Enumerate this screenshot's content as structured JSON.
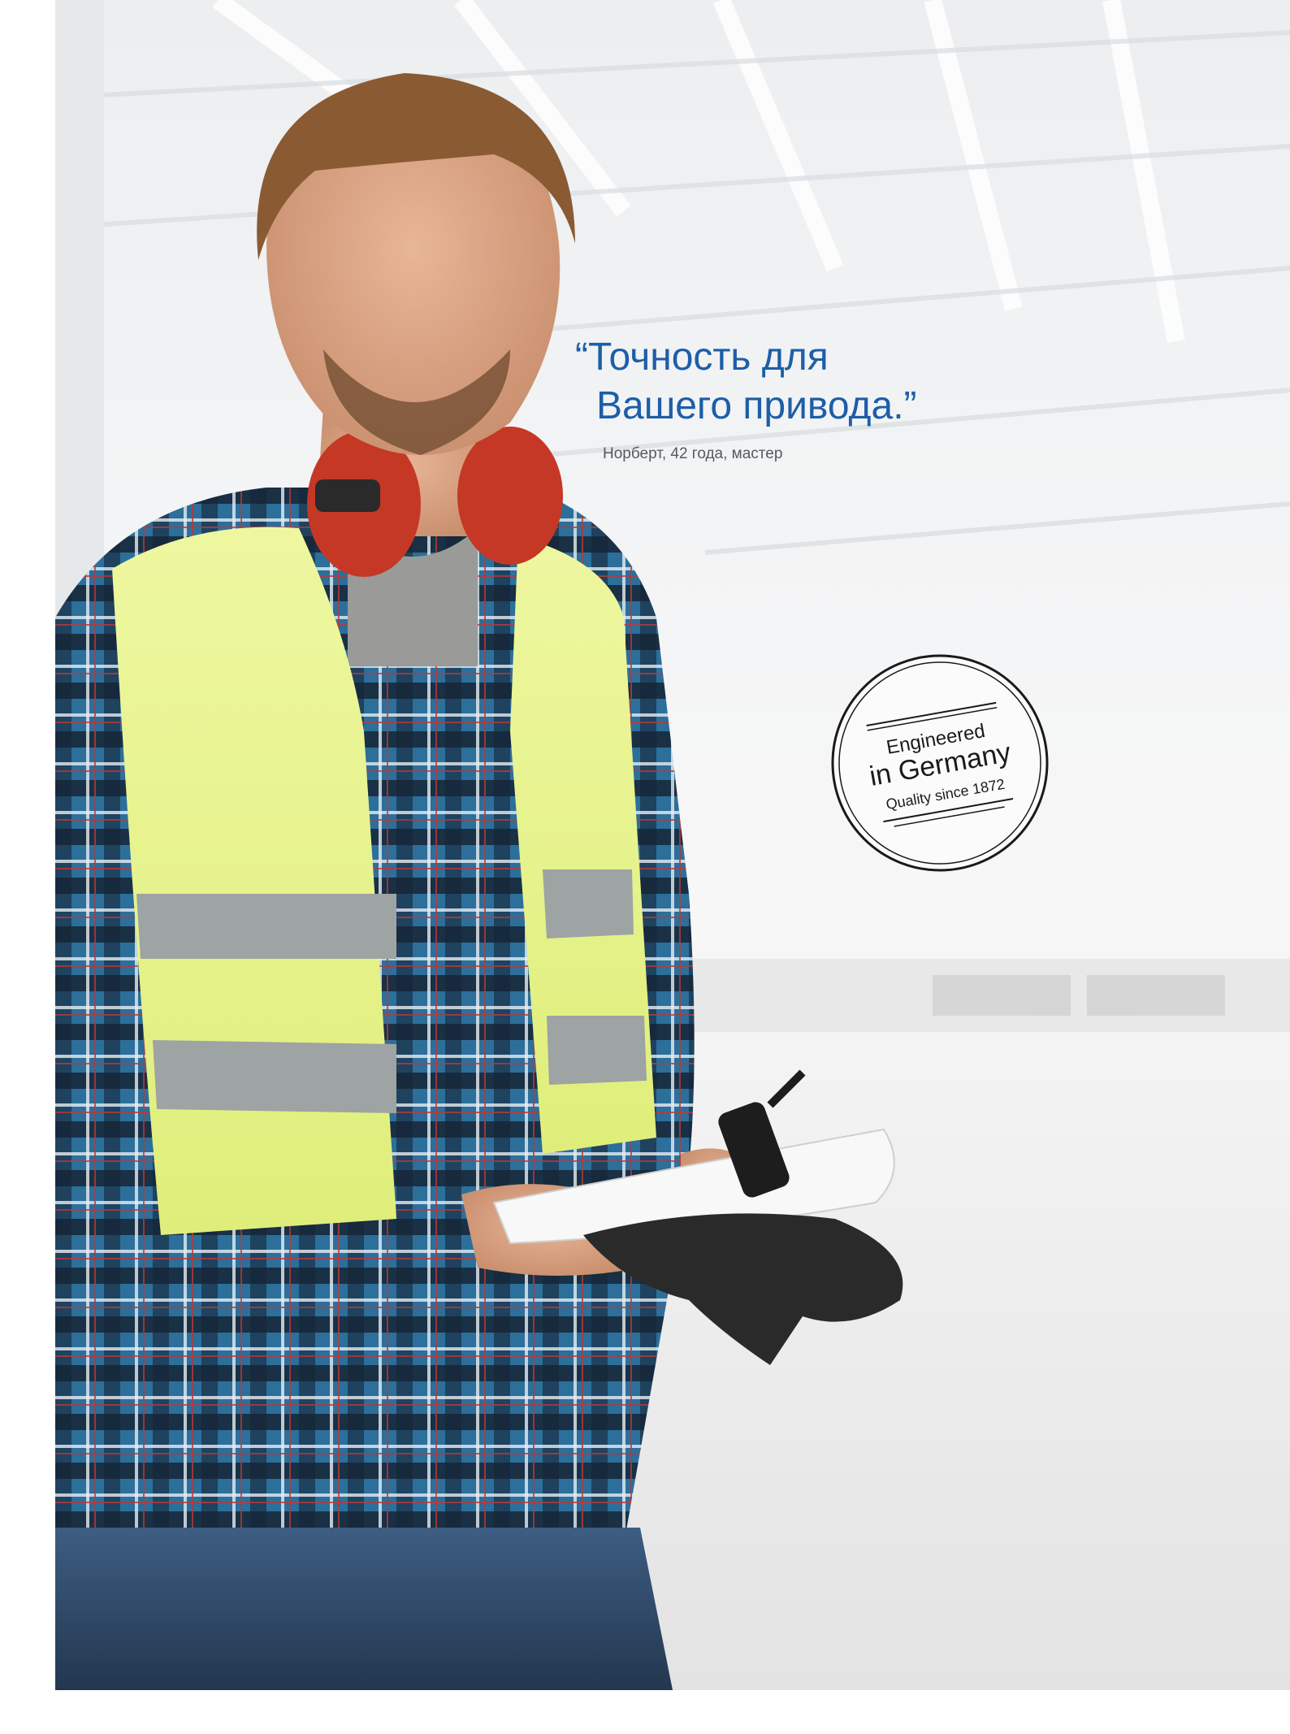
{
  "quote": {
    "line1": "“Точность для",
    "line2": "Вашего привода.”",
    "attribution": "Норберт, 42 года, мастер",
    "color": "#1d5ea8"
  },
  "stamp": {
    "line1": "Engineered",
    "line2": "in Germany",
    "line3": "Quality since 1872"
  }
}
